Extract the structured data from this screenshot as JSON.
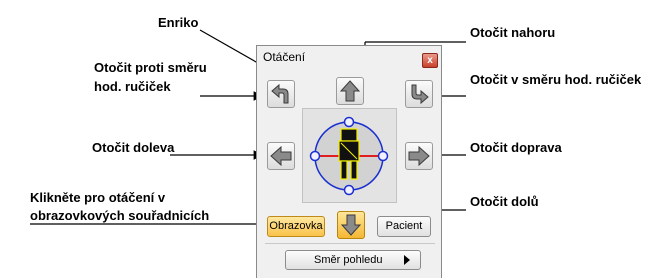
{
  "panel": {
    "title": "Otáčení",
    "close_label": "x",
    "screen_button": "Obrazovka",
    "patient_button": "Pacient",
    "view_direction_button": "Směr pohledu"
  },
  "callouts": {
    "enriko": "Enriko",
    "rotate_up": "Otočit nahoru",
    "rotate_ccw_line1": "Otočit proti směru",
    "rotate_ccw_line2": "hod. ručiček",
    "rotate_cw": "Otočit v směru hod. ručiček",
    "rotate_left": "Otočit doleva",
    "rotate_right": "Otočit doprava",
    "screen_coords_line1": "Klikněte pro otáčení v",
    "screen_coords_line2": "obrazovkových souřadnicích",
    "rotate_down": "Otočit dolů"
  },
  "colors": {
    "arrow_fill": "#8a8a8a",
    "active_fill": "#f5b733",
    "handle_blue": "#1a2fd0",
    "axis_red": "#e02020",
    "figure_yellow": "#f5f000"
  }
}
